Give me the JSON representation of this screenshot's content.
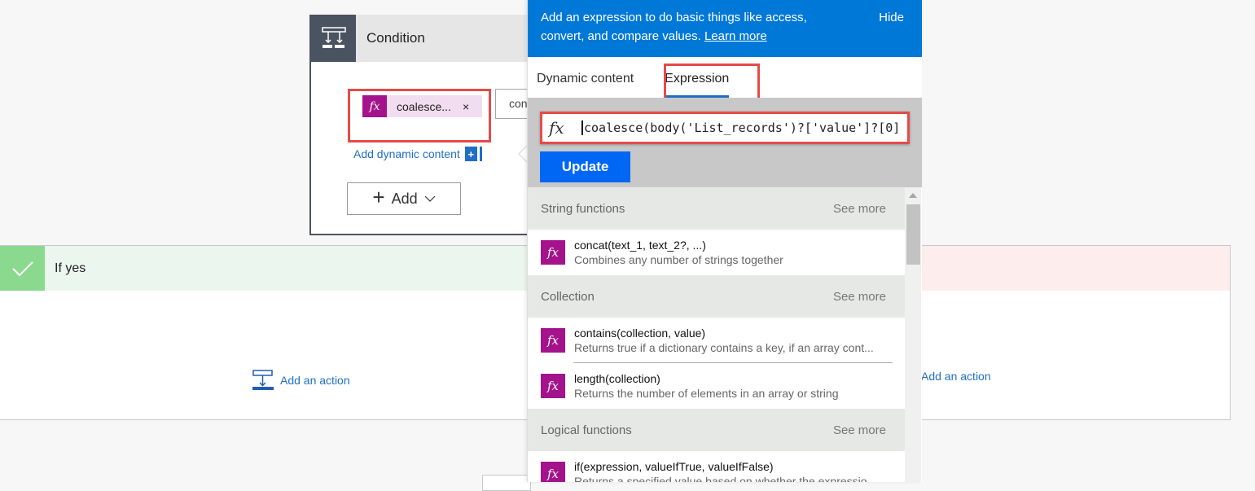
{
  "condition": {
    "title": "Condition",
    "token_label": "coalesce...",
    "token_remove": "×",
    "operator_value": "contains",
    "add_dynamic_label": "Add dynamic content",
    "add_dynamic_plus": "+",
    "add_button_label": "Add",
    "add_button_plus": "+",
    "add_button_chevron": "⌵"
  },
  "branches": {
    "yes": {
      "title": "If yes",
      "add_action_label": "Add an action",
      "color": "#8ad98f"
    },
    "no": {
      "title": "",
      "add_action_label": "Add an action",
      "color": "#fdeded"
    }
  },
  "panel": {
    "banner_text": "Add an expression to do basic things like access, convert, and compare values.",
    "learn_more": "Learn more",
    "hide_label": "Hide",
    "tabs": [
      {
        "label": "Dynamic content",
        "active": false
      },
      {
        "label": "Expression",
        "active": true
      }
    ],
    "fx_symbol": "fx",
    "expression_value": "coalesce(body('List_records')?['value']?[0]",
    "update_label": "Update",
    "sections": [
      {
        "title": "String functions",
        "see_more": "See more",
        "functions": [
          {
            "name": "concat(text_1, text_2?, ...)",
            "desc": "Combines any number of strings together"
          }
        ]
      },
      {
        "title": "Collection",
        "see_more": "See more",
        "functions": [
          {
            "name": "contains(collection, value)",
            "desc": "Returns true if a dictionary contains a key, if an array cont..."
          },
          {
            "name": "length(collection)",
            "desc": "Returns the number of elements in an array or string"
          }
        ]
      },
      {
        "title": "Logical functions",
        "see_more": "See more",
        "functions": [
          {
            "name": "if(expression, valueIfTrue, valueIfFalse)",
            "desc": "Returns a specified value based on whether the expressio..."
          }
        ]
      }
    ]
  },
  "colors": {
    "accent": "#0078d7",
    "update_button": "#0067f5",
    "fx_badge": "#a4138c",
    "highlight": "#e54b4b"
  }
}
